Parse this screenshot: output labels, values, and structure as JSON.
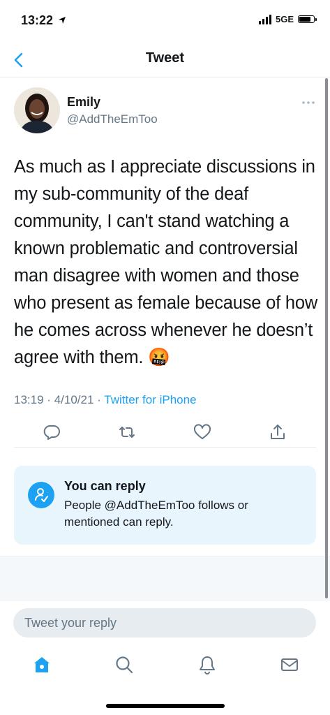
{
  "status_bar": {
    "time": "13:22",
    "network": "5GE"
  },
  "header": {
    "title": "Tweet"
  },
  "tweet": {
    "author_name": "Emily",
    "author_handle": "@AddTheEmToo",
    "text": "As much as I appreciate discussions in my sub-community of the deaf community, I can't stand watching a known problematic and controversial man disagree with women and those who present as female because of how he comes across whenever he doesn’t agree with them. 🤬",
    "time": "13:19",
    "date": "4/10/21",
    "separator": "·",
    "source": "Twitter for iPhone"
  },
  "reply_card": {
    "title": "You can reply",
    "description": "People @AddTheEmToo follows or mentioned can reply."
  },
  "reply_input": {
    "placeholder": "Tweet your reply"
  },
  "colors": {
    "accent": "#1da1f2",
    "secondary_text": "#657786",
    "card_bg": "#e8f5fd"
  },
  "icons": {
    "back": "chevron-left-icon",
    "more": "more-icon",
    "reply": "comment-icon",
    "retweet": "retweet-icon",
    "like": "heart-icon",
    "share": "share-icon",
    "home": "home-icon",
    "search": "search-icon",
    "notifications": "bell-icon",
    "messages": "mail-icon"
  }
}
